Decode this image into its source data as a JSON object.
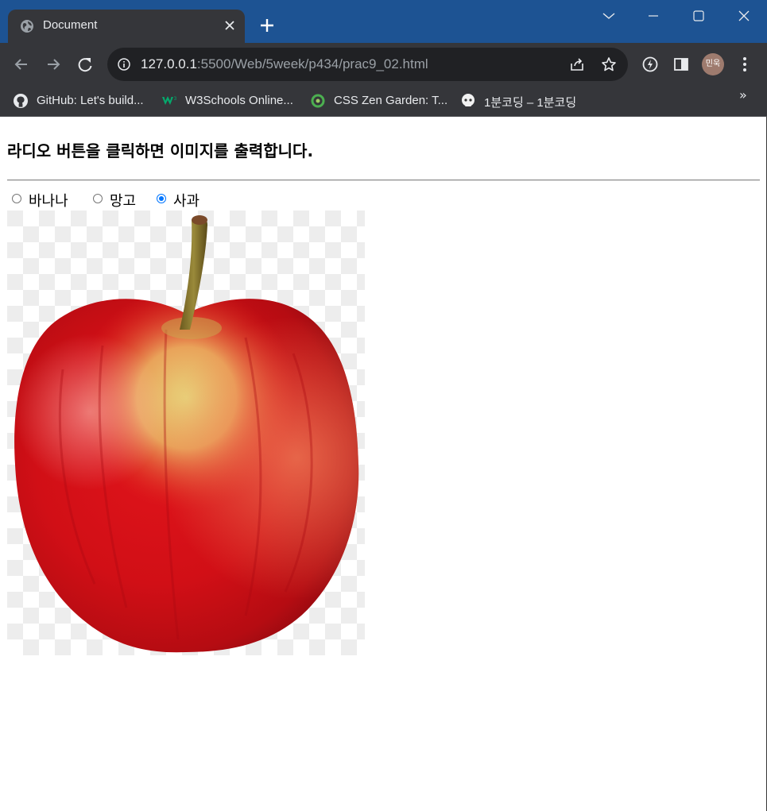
{
  "browser": {
    "tab": {
      "title": "Document"
    },
    "address": {
      "host": "127.0.0.1",
      "path": ":5500/Web/5week/p434/prac9_02.html"
    },
    "profile": {
      "initials": "민욱"
    },
    "bookmarks": [
      {
        "label": "GitHub: Let's build..."
      },
      {
        "label": "W3Schools Online..."
      },
      {
        "label": "CSS Zen Garden: T..."
      },
      {
        "label": "1분코딩 – 1분코딩"
      }
    ],
    "bookmarks_overflow": "»",
    "colors": {
      "titlebar": "#1d5393",
      "toolbar": "#35363a",
      "accent": "#0075ff"
    }
  },
  "page": {
    "heading": "라디오 버튼을 클릭하면 이미지를 출력합니다.",
    "radios": [
      {
        "label": "바나나",
        "checked": false
      },
      {
        "label": "망고",
        "checked": false
      },
      {
        "label": "사과",
        "checked": true
      }
    ],
    "image": {
      "subject": "apple"
    }
  }
}
